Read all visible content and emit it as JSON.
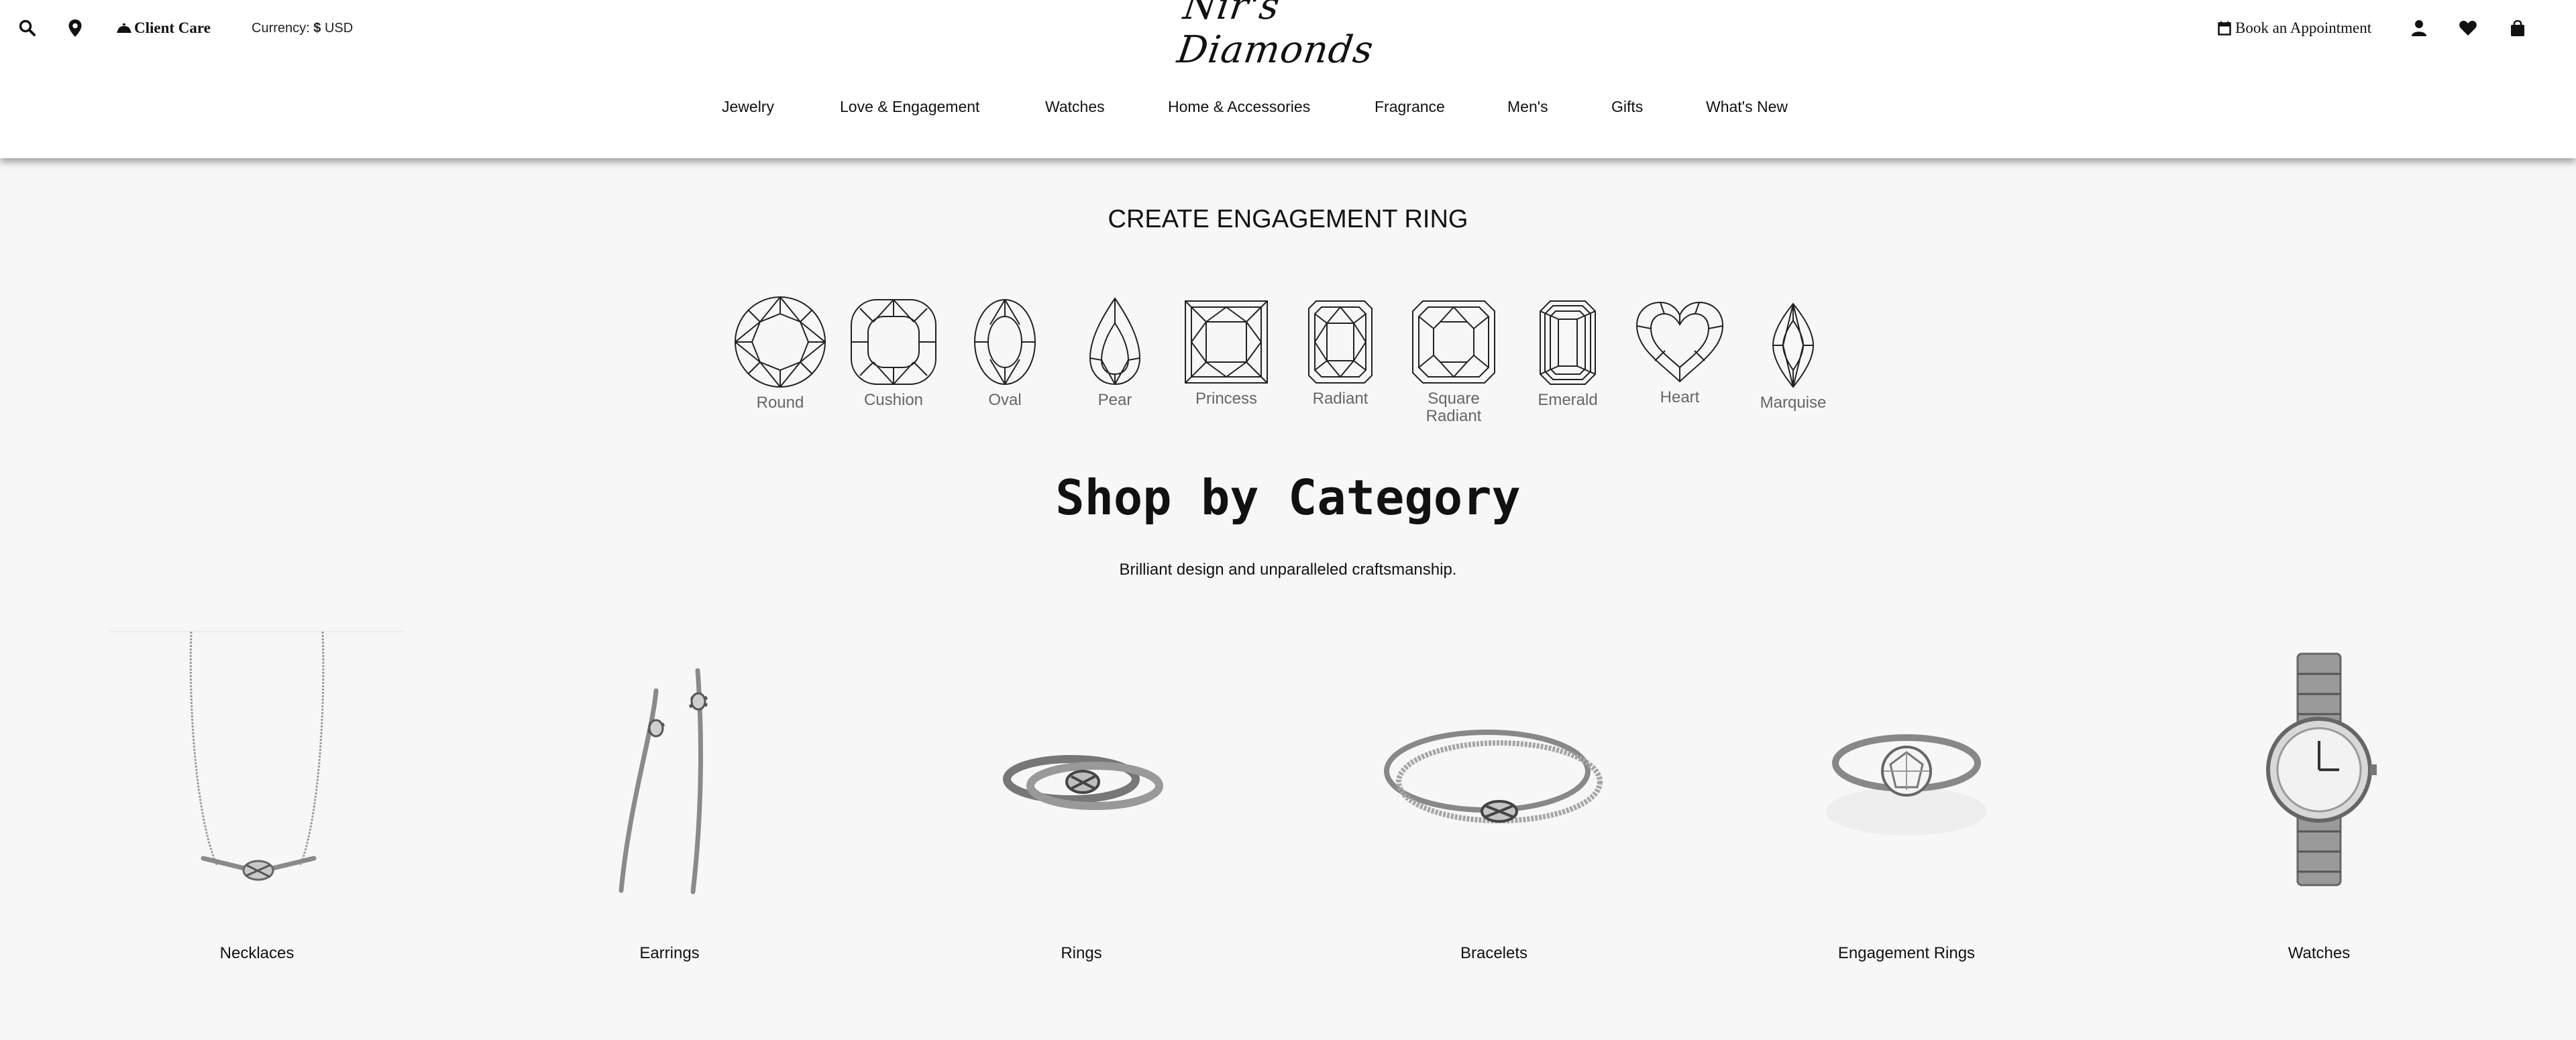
{
  "topbar": {
    "search_icon": "search-icon",
    "location_icon": "location-pin-icon",
    "client_care_label": "Client Care",
    "currency_prefix": "Currency:",
    "currency_symbol": "$",
    "currency_code": "USD",
    "logo_text": "Nir's Diamonds",
    "book_label": "Book an Appointment",
    "account_icon": "user-icon",
    "wishlist_icon": "heart-icon",
    "bag_icon": "shopping-bag-icon"
  },
  "nav": {
    "items": [
      {
        "label": "Jewelry"
      },
      {
        "label": "Love & Engagement"
      },
      {
        "label": "Watches"
      },
      {
        "label": "Home & Accessories"
      },
      {
        "label": "Fragrance"
      },
      {
        "label": "Men's"
      },
      {
        "label": "Gifts"
      },
      {
        "label": "What's New"
      }
    ]
  },
  "engagement": {
    "title": "CREATE ENGAGEMENT RING",
    "shapes": [
      {
        "label": "Round",
        "icon": "round-diamond-icon"
      },
      {
        "label": "Cushion",
        "icon": "cushion-diamond-icon"
      },
      {
        "label": "Oval",
        "icon": "oval-diamond-icon"
      },
      {
        "label": "Pear",
        "icon": "pear-diamond-icon"
      },
      {
        "label": "Princess",
        "icon": "princess-diamond-icon"
      },
      {
        "label": "Radiant",
        "icon": "radiant-diamond-icon"
      },
      {
        "label": "Square Radiant",
        "icon": "square-radiant-diamond-icon"
      },
      {
        "label": "Emerald",
        "icon": "emerald-diamond-icon"
      },
      {
        "label": "Heart",
        "icon": "heart-diamond-icon"
      },
      {
        "label": "Marquise",
        "icon": "marquise-diamond-icon"
      }
    ]
  },
  "categories": {
    "title": "Shop by Category",
    "subtitle": "Brilliant design and unparalleled craftsmanship.",
    "items": [
      {
        "label": "Necklaces"
      },
      {
        "label": "Earrings"
      },
      {
        "label": "Rings"
      },
      {
        "label": "Bracelets"
      },
      {
        "label": "Engagement Rings"
      },
      {
        "label": "Watches"
      }
    ]
  }
}
